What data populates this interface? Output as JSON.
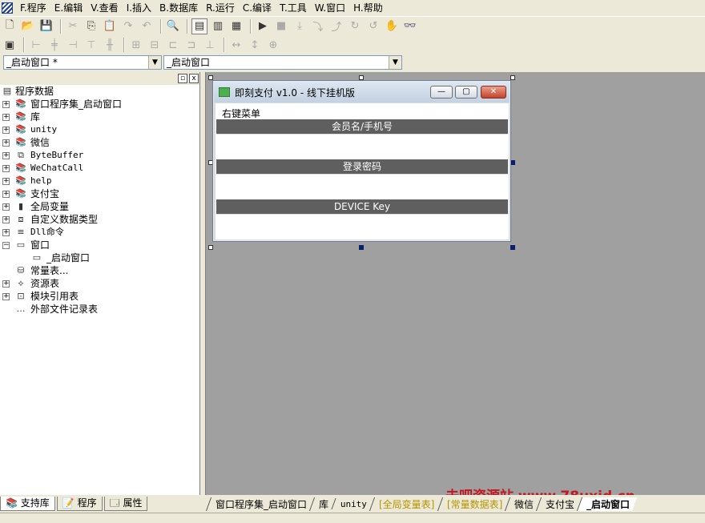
{
  "menu": {
    "items": [
      "F.程序",
      "E.编辑",
      "V.查看",
      "I.插入",
      "B.数据库",
      "R.运行",
      "C.编译",
      "T.工具",
      "W.窗口",
      "H.帮助"
    ]
  },
  "toolbar1": {
    "icons": [
      "new-file-icon",
      "open-folder-icon",
      "save-icon",
      "cut-icon",
      "copy-icon",
      "paste-icon",
      "redo-icon",
      "undo-icon",
      "find-icon",
      "layout-1-icon",
      "layout-2-icon",
      "layout-3-icon",
      "run-icon",
      "stop-icon",
      "step-icon",
      "step-into-icon",
      "step-out-icon",
      "step-over-icon",
      "step-back-icon",
      "hand-icon",
      "binoculars-icon"
    ]
  },
  "toolbar2": {
    "icons": [
      "form-icon",
      "align-left-icon",
      "align-center-icon",
      "align-right-icon",
      "align-top-icon",
      "align-middle-icon",
      "align-bottom-icon",
      "center-h-icon",
      "center-v-icon",
      "space-h-icon",
      "space-v-icon",
      "same-width-icon",
      "same-height-icon",
      "same-size-icon"
    ]
  },
  "combos": {
    "left": "_启动窗口 *",
    "right": "_启动窗口"
  },
  "panel": {
    "pin_label": "▫",
    "close_label": "x"
  },
  "tree": {
    "root": "程序数据",
    "items": [
      {
        "label": "窗口程序集_启动窗口",
        "icon": "books-icon",
        "expander": "+"
      },
      {
        "label": "库",
        "icon": "books-icon",
        "expander": "+"
      },
      {
        "label": "unity",
        "icon": "books-icon",
        "expander": "+",
        "mono": true
      },
      {
        "label": "微信",
        "icon": "books-icon",
        "expander": "+"
      },
      {
        "label": "ByteBuffer",
        "icon": "class-icon",
        "expander": "+",
        "mono": true
      },
      {
        "label": "WeChatCall",
        "icon": "books-icon",
        "expander": "+",
        "mono": true
      },
      {
        "label": "help",
        "icon": "books-icon",
        "expander": "+",
        "mono": true
      },
      {
        "label": "支付宝",
        "icon": "books-icon",
        "expander": "+"
      },
      {
        "label": "全局变量",
        "icon": "variable-icon",
        "expander": "+"
      },
      {
        "label": "自定义数据类型",
        "icon": "datatype-icon",
        "expander": "+"
      },
      {
        "label": "Dll命令",
        "icon": "dll-icon",
        "expander": "+",
        "mono": true
      },
      {
        "label": "窗口",
        "icon": "window-icon",
        "expander": "−"
      },
      {
        "label": "_启动窗口",
        "icon": "window-icon",
        "expander": "",
        "child": true
      },
      {
        "label": "常量表...",
        "icon": "constant-icon",
        "expander": ""
      },
      {
        "label": "资源表",
        "icon": "resource-icon",
        "expander": "+"
      },
      {
        "label": "模块引用表",
        "icon": "module-icon",
        "expander": "+"
      },
      {
        "label": "外部文件记录表",
        "icon": "file-record-icon",
        "expander": ""
      }
    ]
  },
  "left_tabs": [
    "支持库",
    "程序",
    "属性"
  ],
  "form": {
    "title": "即刻支付 v1.0 - 线下挂机版",
    "context_label": "右键菜单",
    "fields": [
      {
        "header": "会员名/手机号"
      },
      {
        "header": "登录密码"
      },
      {
        "header": "DEVICE Key"
      }
    ],
    "buttons": {
      "minimize": "—",
      "maximize": "▢",
      "close": "✕"
    }
  },
  "doc_tabs": [
    {
      "label": "窗口程序集_启动窗口",
      "style": "normal"
    },
    {
      "label": "库",
      "style": "normal"
    },
    {
      "label": "unity",
      "style": "normal"
    },
    {
      "label": "[全局变量表]",
      "style": "yellow"
    },
    {
      "label": "[常量数据表]",
      "style": "yellow"
    },
    {
      "label": "微信",
      "style": "normal"
    },
    {
      "label": "支付宝",
      "style": "normal"
    },
    {
      "label": "_启动窗口",
      "style": "active"
    }
  ],
  "watermark": "去吧资源站 www.78uxjd.cn"
}
